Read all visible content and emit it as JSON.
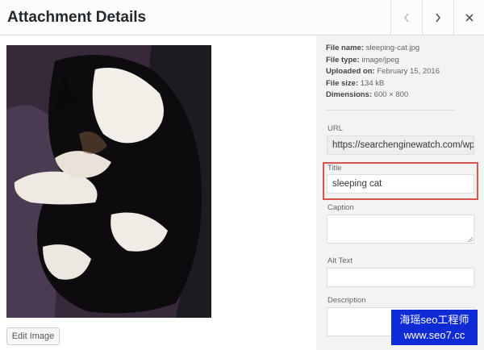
{
  "header": {
    "title": "Attachment Details",
    "prev_icon": "chevron-left-icon",
    "next_icon": "chevron-right-icon",
    "close_icon": "close-icon"
  },
  "image": {
    "description_icon": "sleeping-cat-photo",
    "edit_label": "Edit Image"
  },
  "meta": {
    "file_name_label": "File name:",
    "file_name": "sleeping-cat.jpg",
    "file_type_label": "File type:",
    "file_type": "image/jpeg",
    "uploaded_label": "Uploaded on:",
    "uploaded": "February 15, 2016",
    "file_size_label": "File size:",
    "file_size": "134 kB",
    "dimensions_label": "Dimensions:",
    "dimensions": "600 × 800"
  },
  "fields": {
    "url_label": "URL",
    "url_value": "https://searchenginewatch.com/wp-content",
    "title_label": "Title",
    "title_value": "sleeping cat",
    "caption_label": "Caption",
    "caption_value": "",
    "alt_label": "Alt Text",
    "alt_value": "",
    "description_label": "Description",
    "description_value": ""
  },
  "watermark": {
    "line1": "海瑶seo工程师",
    "line2": "www.seo7.cc"
  },
  "colors": {
    "highlight": "#d9534f",
    "watermark_bg": "#0f2bd6"
  }
}
